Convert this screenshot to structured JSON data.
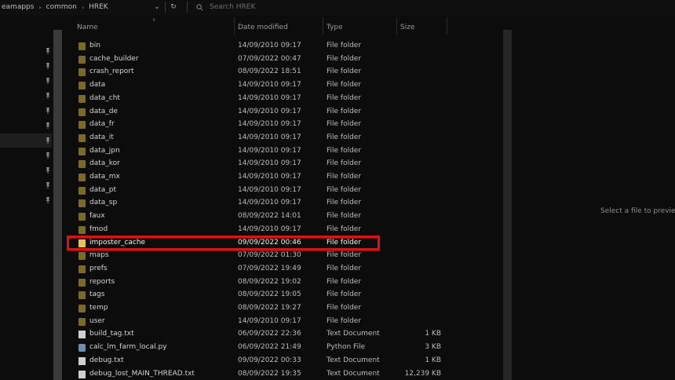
{
  "breadcrumb": [
    "eamapps",
    "common",
    "HREK"
  ],
  "search": {
    "placeholder": "Search HREK"
  },
  "columns": {
    "name": "Name",
    "date": "Date modified",
    "type": "Type",
    "size": "Size"
  },
  "files": [
    {
      "name": "bin",
      "date": "14/09/2010 09:17",
      "type": "File folder",
      "size": "",
      "icon": "folder-icon"
    },
    {
      "name": "cache_builder",
      "date": "07/09/2022 00:47",
      "type": "File folder",
      "size": "",
      "icon": "folder-icon"
    },
    {
      "name": "crash_report",
      "date": "08/09/2022 18:51",
      "type": "File folder",
      "size": "",
      "icon": "folder-icon"
    },
    {
      "name": "data",
      "date": "14/09/2010 09:17",
      "type": "File folder",
      "size": "",
      "icon": "folder-icon"
    },
    {
      "name": "data_cht",
      "date": "14/09/2010 09:17",
      "type": "File folder",
      "size": "",
      "icon": "folder-icon"
    },
    {
      "name": "data_de",
      "date": "14/09/2010 09:17",
      "type": "File folder",
      "size": "",
      "icon": "folder-icon"
    },
    {
      "name": "data_fr",
      "date": "14/09/2010 09:17",
      "type": "File folder",
      "size": "",
      "icon": "folder-icon"
    },
    {
      "name": "data_it",
      "date": "14/09/2010 09:17",
      "type": "File folder",
      "size": "",
      "icon": "folder-icon"
    },
    {
      "name": "data_jpn",
      "date": "14/09/2010 09:17",
      "type": "File folder",
      "size": "",
      "icon": "folder-icon"
    },
    {
      "name": "data_kor",
      "date": "14/09/2010 09:17",
      "type": "File folder",
      "size": "",
      "icon": "folder-icon"
    },
    {
      "name": "data_mx",
      "date": "14/09/2010 09:17",
      "type": "File folder",
      "size": "",
      "icon": "folder-icon"
    },
    {
      "name": "data_pt",
      "date": "14/09/2010 09:17",
      "type": "File folder",
      "size": "",
      "icon": "folder-icon"
    },
    {
      "name": "data_sp",
      "date": "14/09/2010 09:17",
      "type": "File folder",
      "size": "",
      "icon": "folder-icon"
    },
    {
      "name": "faux",
      "date": "08/09/2022 14:01",
      "type": "File folder",
      "size": "",
      "icon": "folder-icon"
    },
    {
      "name": "fmod",
      "date": "14/09/2010 09:17",
      "type": "File folder",
      "size": "",
      "icon": "folder-icon"
    },
    {
      "name": "imposter_cache",
      "date": "09/09/2022 00:46",
      "type": "File folder",
      "size": "",
      "icon": "folder-icon",
      "highlighted": true
    },
    {
      "name": "maps",
      "date": "07/09/2022 01:30",
      "type": "File folder",
      "size": "",
      "icon": "folder-icon"
    },
    {
      "name": "prefs",
      "date": "07/09/2022 19:49",
      "type": "File folder",
      "size": "",
      "icon": "folder-icon"
    },
    {
      "name": "reports",
      "date": "08/09/2022 19:02",
      "type": "File folder",
      "size": "",
      "icon": "folder-icon"
    },
    {
      "name": "tags",
      "date": "08/09/2022 19:05",
      "type": "File folder",
      "size": "",
      "icon": "folder-icon"
    },
    {
      "name": "temp",
      "date": "08/09/2022 19:27",
      "type": "File folder",
      "size": "",
      "icon": "folder-icon"
    },
    {
      "name": "user",
      "date": "14/09/2010 09:17",
      "type": "File folder",
      "size": "",
      "icon": "folder-icon"
    },
    {
      "name": "build_tag.txt",
      "date": "06/09/2022 22:36",
      "type": "Text Document",
      "size": "1 KB",
      "icon": "text-file-icon"
    },
    {
      "name": "calc_lm_farm_local.py",
      "date": "06/09/2022 21:49",
      "type": "Python File",
      "size": "3 KB",
      "icon": "python-file-icon"
    },
    {
      "name": "debug.txt",
      "date": "09/09/2022 00:33",
      "type": "Text Document",
      "size": "1 KB",
      "icon": "text-file-icon"
    },
    {
      "name": "debug_lost_MAIN_THREAD.txt",
      "date": "08/09/2022 19:35",
      "type": "Text Document",
      "size": "12,239 KB",
      "icon": "text-file-icon"
    }
  ],
  "preview": {
    "message": "Select a file to preview."
  },
  "colors": {
    "highlight_border": "#e01010",
    "folder": "#e6c25a",
    "background": "#0c0c0c"
  }
}
